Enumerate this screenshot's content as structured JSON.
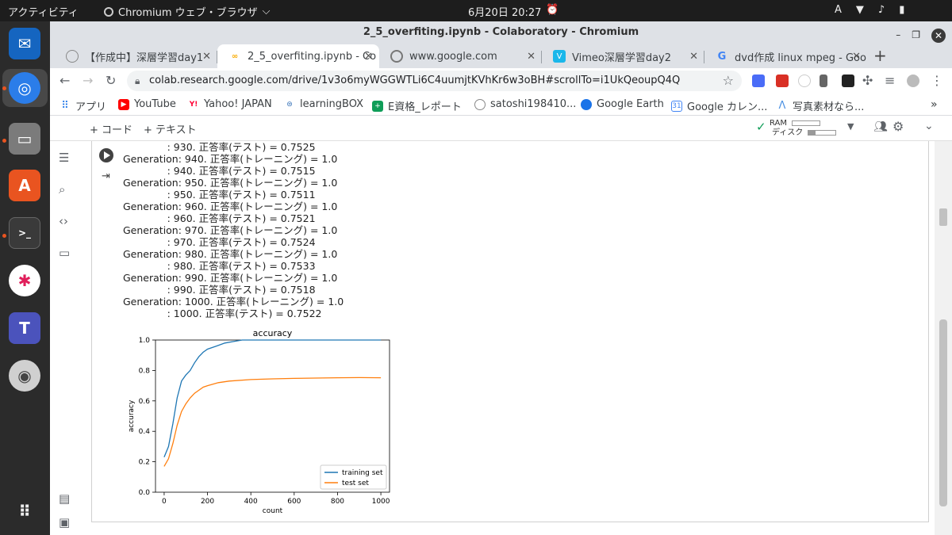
{
  "topbar": {
    "activities": "アクティビティ",
    "app_name": "Chromium ウェブ・ブラウザ",
    "clock": "6月20日 20:27",
    "input_method": "A"
  },
  "window": {
    "title": "2_5_overfiting.ipynb - Colaboratory - Chromium"
  },
  "tabs": [
    {
      "label": "【作成中】深層学習day1",
      "active": false
    },
    {
      "label": "2_5_overfiting.ipynb - Co",
      "active": true
    },
    {
      "label": "www.google.com",
      "active": false
    },
    {
      "label": "Vimeo深層学習day2",
      "active": false
    },
    {
      "label": "dvd作成 linux mpeg - Goo",
      "active": false
    }
  ],
  "omnibox": {
    "url": "colab.research.google.com/drive/1v3o6myWGGWTLi6C4uumjtKVhKr6w3oBH#scrollTo=i1UkQeoupQ4Q"
  },
  "bookmarks": [
    {
      "label": "アプリ",
      "color": "#1a73e8"
    },
    {
      "label": "YouTube",
      "color": "#ff0000"
    },
    {
      "label": "Yahoo! JAPAN",
      "color": "#ff0033"
    },
    {
      "label": "learningBOX",
      "color": "#2f6db5"
    },
    {
      "label": "E資格_レポート",
      "color": "#0f9d58"
    },
    {
      "label": "satoshi198410...",
      "color": "#777777"
    },
    {
      "label": "Google Earth",
      "color": "#1a73e8"
    },
    {
      "label": "Google カレン...",
      "color": "#4285f4"
    },
    {
      "label": "写真素材なら...",
      "color": "#4a90e2"
    }
  ],
  "colab": {
    "add_code": "+ コード",
    "add_text": "+ テキスト",
    "ram_label": "RAM",
    "disk_label": "ディスク"
  },
  "output_lines": [
    "              : 930. 正答率(テスト) = 0.7525",
    "Generation: 940. 正答率(トレーニング) = 1.0",
    "              : 940. 正答率(テスト) = 0.7515",
    "Generation: 950. 正答率(トレーニング) = 1.0",
    "              : 950. 正答率(テスト) = 0.7511",
    "Generation: 960. 正答率(トレーニング) = 1.0",
    "              : 960. 正答率(テスト) = 0.7521",
    "Generation: 970. 正答率(トレーニング) = 1.0",
    "              : 970. 正答率(テスト) = 0.7524",
    "Generation: 980. 正答率(トレーニング) = 1.0",
    "              : 980. 正答率(テスト) = 0.7533",
    "Generation: 990. 正答率(トレーニング) = 1.0",
    "              : 990. 正答率(テスト) = 0.7518",
    "Generation: 1000. 正答率(トレーニング) = 1.0",
    "              : 1000. 正答率(テスト) = 0.7522"
  ],
  "chart_data": {
    "type": "line",
    "title": "accuracy",
    "xlabel": "count",
    "ylabel": "accuracy",
    "xlim": [
      -40,
      1040
    ],
    "ylim": [
      0.0,
      1.0
    ],
    "xticks": [
      0,
      200,
      400,
      600,
      800,
      1000
    ],
    "yticks": [
      0.0,
      0.2,
      0.4,
      0.6,
      0.8,
      1.0
    ],
    "ytick_labels": [
      "0.0",
      "0.2",
      "0.4",
      "0.6",
      "0.8",
      "1.0"
    ],
    "legend_position": "lower-right",
    "series": [
      {
        "name": "training set",
        "color": "#1f77b4",
        "x": [
          0,
          20,
          40,
          60,
          80,
          100,
          120,
          140,
          160,
          180,
          200,
          240,
          280,
          320,
          360,
          400,
          1000
        ],
        "y": [
          0.23,
          0.3,
          0.45,
          0.62,
          0.73,
          0.77,
          0.8,
          0.85,
          0.89,
          0.92,
          0.94,
          0.96,
          0.98,
          0.99,
          1.0,
          1.0,
          1.0
        ]
      },
      {
        "name": "test set",
        "color": "#ff7f0e",
        "x": [
          0,
          20,
          40,
          60,
          80,
          100,
          120,
          140,
          160,
          180,
          200,
          250,
          300,
          400,
          500,
          600,
          700,
          800,
          900,
          1000
        ],
        "y": [
          0.17,
          0.22,
          0.32,
          0.44,
          0.53,
          0.58,
          0.62,
          0.65,
          0.67,
          0.69,
          0.7,
          0.72,
          0.73,
          0.74,
          0.745,
          0.748,
          0.75,
          0.752,
          0.753,
          0.752
        ]
      }
    ]
  }
}
